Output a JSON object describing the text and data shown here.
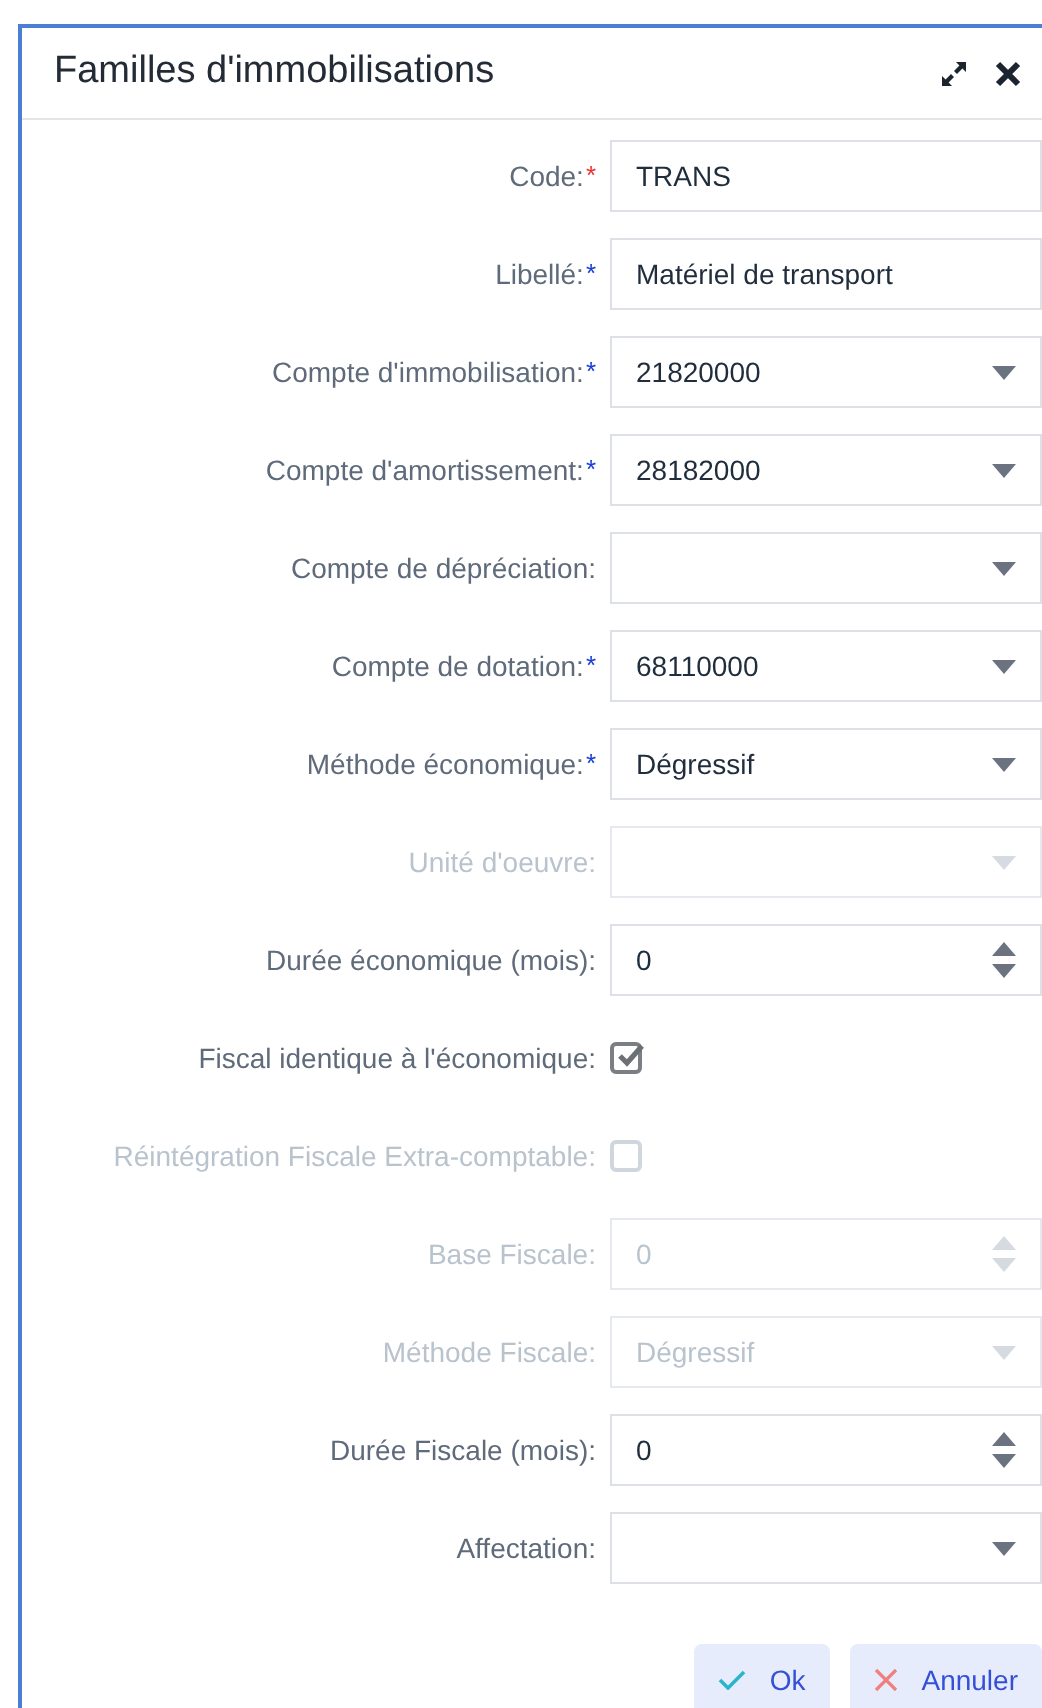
{
  "window": {
    "title": "Familles d'immobilisations"
  },
  "fields": [
    {
      "kind": "text",
      "label": "Code:",
      "mark": "*",
      "color": "#e53935",
      "value": "TRANS",
      "disabled": false
    },
    {
      "kind": "text",
      "label": "Libellé:",
      "mark": "*",
      "color": "#1a3fd6",
      "value": "Matériel de transport",
      "disabled": false
    },
    {
      "kind": "select",
      "label": "Compte d'immobilisation:",
      "mark": "*",
      "color": "#1a3fd6",
      "value": "21820000",
      "disabled": false
    },
    {
      "kind": "select",
      "label": "Compte d'amortissement:",
      "mark": "*",
      "color": "#1a3fd6",
      "value": "28182000",
      "disabled": false
    },
    {
      "kind": "select",
      "label": "Compte de dépréciation:",
      "disabled": false
    },
    {
      "kind": "select",
      "label": "Compte de dotation:",
      "mark": "*",
      "color": "#1a3fd6",
      "value": "68110000",
      "disabled": false
    },
    {
      "kind": "select",
      "label": "Méthode économique:",
      "mark": "*",
      "color": "#1a3fd6",
      "value": "Dégressif",
      "disabled": false
    },
    {
      "kind": "select",
      "label": "Unité d'oeuvre:",
      "disabled": true
    },
    {
      "kind": "number",
      "label": "Durée économique (mois):",
      "value": "0",
      "disabled": false
    },
    {
      "kind": "checkbox",
      "label": "Fiscal identique à l'économique:",
      "checked": true,
      "disabled": false
    },
    {
      "kind": "checkbox",
      "label": "Réintégration Fiscale Extra-comptable:",
      "checked": false,
      "disabled": true
    },
    {
      "kind": "number",
      "label": "Base Fiscale:",
      "value": "0",
      "disabled": true
    },
    {
      "kind": "select",
      "label": "Méthode Fiscale:",
      "value": "Dégressif",
      "disabled": true
    },
    {
      "kind": "number",
      "label": "Durée Fiscale (mois):",
      "value": "0",
      "disabled": false
    },
    {
      "kind": "select",
      "label": "Affectation:",
      "disabled": false
    }
  ],
  "buttons": [
    {
      "kind": "ok",
      "label": "Ok"
    },
    {
      "kind": "cancel",
      "label": "Annuler"
    }
  ]
}
